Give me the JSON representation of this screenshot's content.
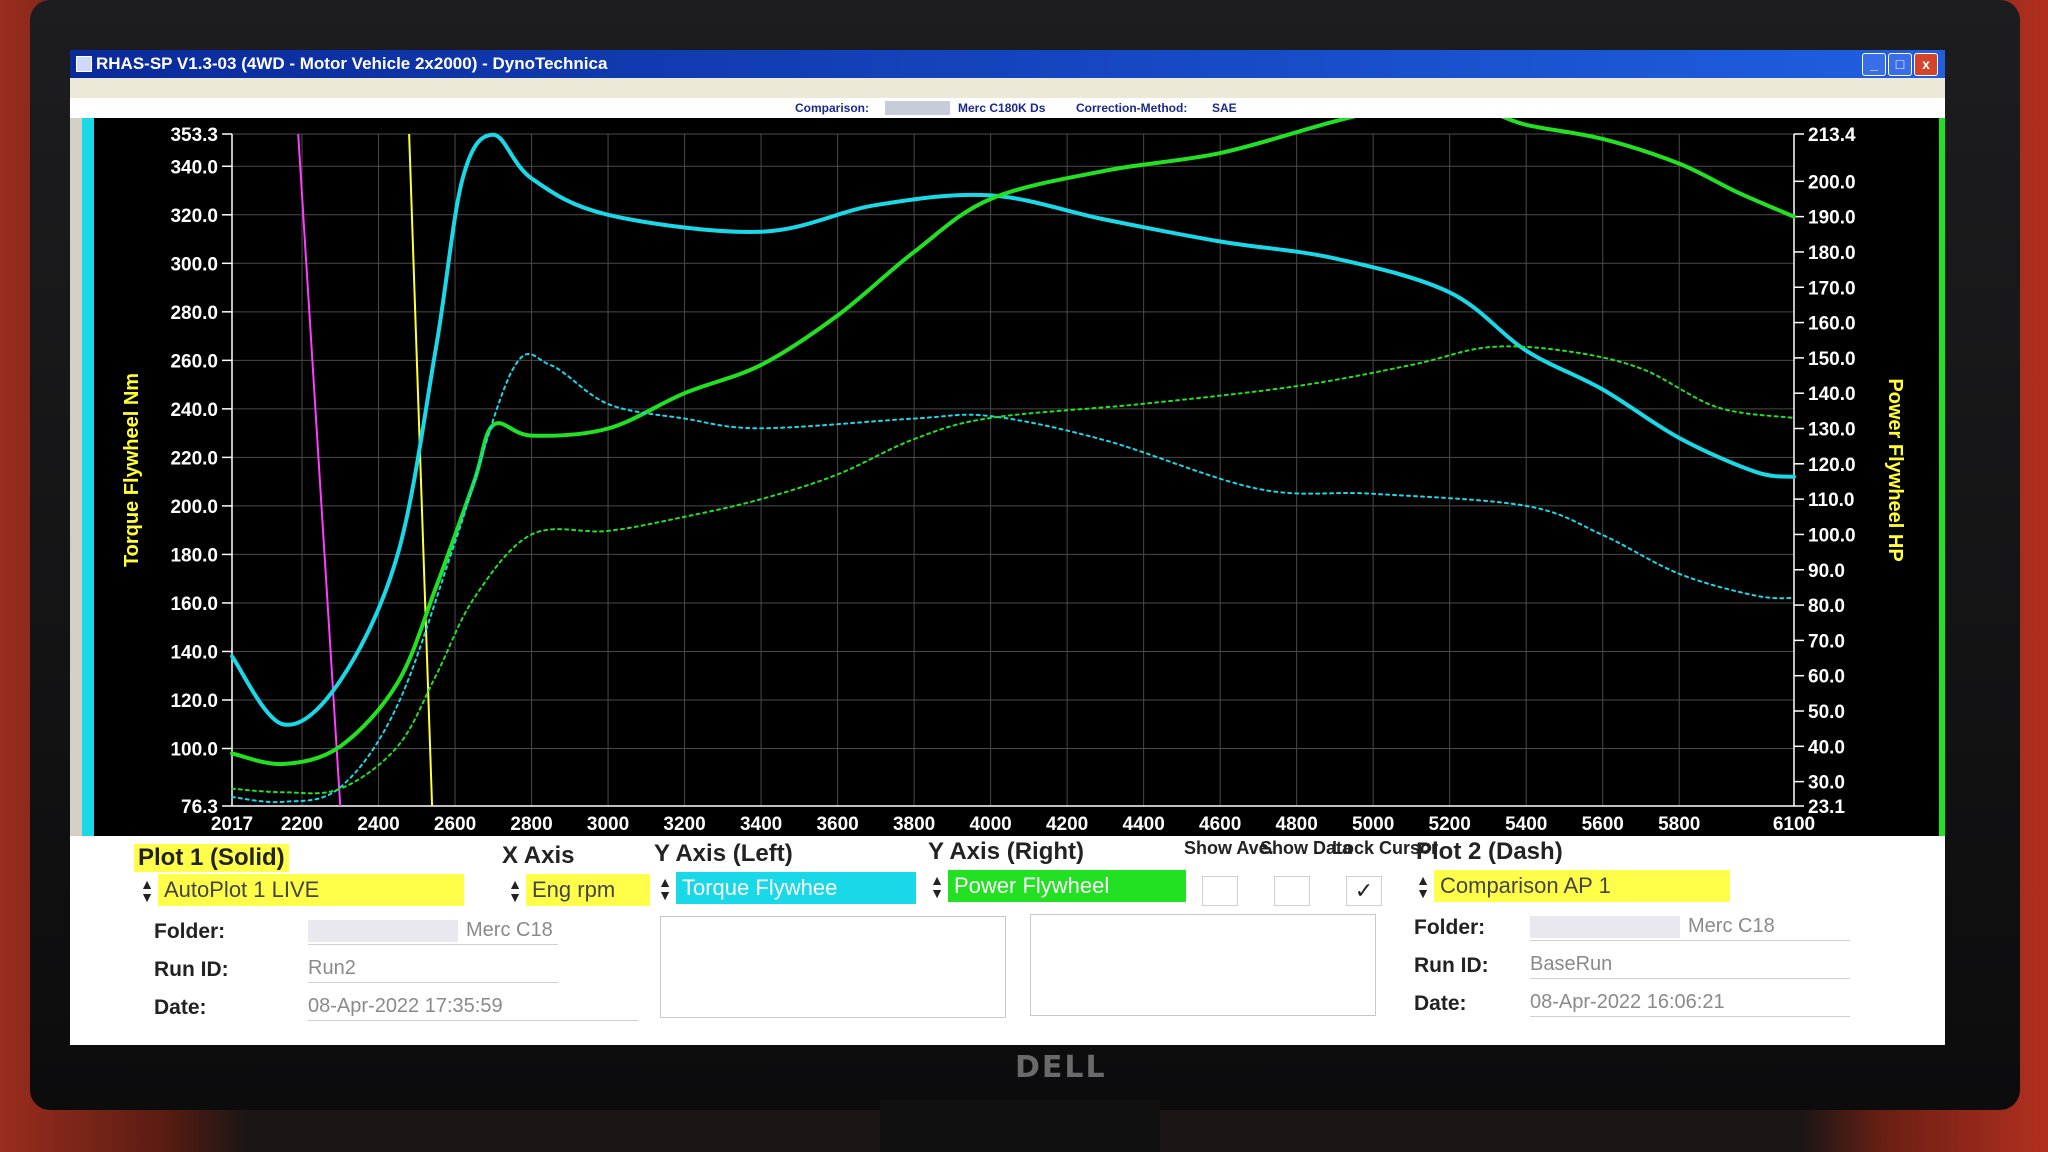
{
  "window": {
    "title": "RHAS-SP V1.3-03  (4WD - Motor Vehicle 2x2000) - DynoTechnica",
    "controls": {
      "minimize": "_",
      "maximize": "□",
      "close": "x"
    }
  },
  "infobar": {
    "comparison_label": "Comparison:",
    "comparison_value": "Merc C180K Ds",
    "correction_label": "Correction-Method:",
    "correction_value": "SAE"
  },
  "chart_data": {
    "type": "line",
    "x_ticks": [
      "2017",
      "2200",
      "2400",
      "2600",
      "2800",
      "3000",
      "3200",
      "3400",
      "3600",
      "3800",
      "4000",
      "4200",
      "4400",
      "4600",
      "4800",
      "5000",
      "5200",
      "5400",
      "5600",
      "5800",
      "6100"
    ],
    "x_range": [
      2017,
      6100
    ],
    "y_left": {
      "label": "Torque Flywheel Nm",
      "range": [
        76.3,
        353.3
      ],
      "ticks": [
        "353.3",
        "340.0",
        "320.0",
        "300.0",
        "280.0",
        "260.0",
        "240.0",
        "220.0",
        "200.0",
        "180.0",
        "160.0",
        "140.0",
        "120.0",
        "100.0",
        "76.3"
      ]
    },
    "y_right": {
      "label": "Power Flywheel HP",
      "range": [
        23.1,
        213.4
      ],
      "ticks": [
        "213.4",
        "200.0",
        "190.0",
        "180.0",
        "170.0",
        "160.0",
        "150.0",
        "140.0",
        "130.0",
        "120.0",
        "110.0",
        "100.0",
        "90.0",
        "80.0",
        "70.0",
        "60.0",
        "50.0",
        "40.0",
        "30.0",
        "23.1"
      ]
    },
    "grid": true,
    "series": [
      {
        "axis": "left",
        "color": "#19d8e8",
        "style": "solid",
        "x": [
          2017,
          2150,
          2300,
          2450,
          2550,
          2620,
          2700,
          2800,
          3000,
          3400,
          3700,
          4000,
          4300,
          4600,
          4900,
          5200,
          5400,
          5600,
          5800,
          6000,
          6100
        ],
        "y": [
          138,
          110,
          128,
          180,
          265,
          335,
          353,
          335,
          320,
          313,
          324,
          328,
          318,
          309,
          302,
          288,
          264,
          248,
          228,
          214,
          212
        ]
      },
      {
        "axis": "right",
        "color": "#22e022",
        "style": "solid",
        "x": [
          2017,
          2150,
          2300,
          2450,
          2550,
          2650,
          2700,
          2800,
          3000,
          3200,
          3400,
          3600,
          3800,
          4000,
          4300,
          4600,
          4900,
          5100,
          5200,
          5300,
          5400,
          5600,
          5800,
          5950,
          6100
        ],
        "y": [
          38,
          35,
          40,
          58,
          85,
          115,
          131,
          128,
          130,
          140,
          148,
          162,
          180,
          195,
          203,
          208,
          217,
          222,
          223,
          220,
          216,
          212,
          205,
          197,
          190
        ]
      },
      {
        "axis": "left",
        "color": "#19d8e8",
        "style": "dash",
        "x": [
          2017,
          2150,
          2300,
          2450,
          2600,
          2750,
          2850,
          3000,
          3200,
          3400,
          3800,
          4000,
          4300,
          4700,
          5000,
          5400,
          5600,
          5800,
          6000,
          6100
        ],
        "y": [
          80,
          78,
          84,
          118,
          185,
          256,
          258,
          242,
          236,
          232,
          236,
          237,
          227,
          207,
          205,
          200,
          188,
          172,
          163,
          162
        ]
      },
      {
        "axis": "right",
        "color": "#22e022",
        "style": "dash",
        "x": [
          2017,
          2150,
          2300,
          2450,
          2550,
          2650,
          2800,
          3000,
          3200,
          3400,
          3600,
          3800,
          4000,
          4400,
          4800,
          5100,
          5300,
          5500,
          5700,
          5900,
          6100
        ],
        "y": [
          28,
          27,
          28,
          40,
          60,
          82,
          100,
          101,
          105,
          110,
          117,
          127,
          133,
          137,
          142,
          148,
          153,
          152,
          147,
          136,
          133
        ]
      }
    ],
    "cursor_lines": [
      {
        "color": "#ff3cff",
        "x_top": 2190,
        "x_bottom": 2300
      },
      {
        "color": "#ffff33",
        "x_top": 2480,
        "x_bottom": 2540
      }
    ]
  },
  "panel": {
    "plot1": {
      "header": "Plot 1 (Solid)",
      "select": "AutoPlot 1 LIVE",
      "folder_label": "Folder:",
      "folder_value": "Merc C18",
      "runid_label": "Run ID:",
      "runid_value": "Run2",
      "date_label": "Date:",
      "date_value": "08-Apr-2022   17:35:59"
    },
    "x_axis": {
      "header": "X Axis",
      "select": "Eng rpm"
    },
    "y_left": {
      "header": "Y Axis (Left)",
      "select": "Torque Flywhee"
    },
    "y_right": {
      "header": "Y Axis (Right)",
      "select": "Power Flywheel"
    },
    "options": {
      "show_ave": "Show Ave.",
      "show_data": "Show Data",
      "lock_cursor": "Lock Cursor",
      "lock_cursor_checked": "✓"
    },
    "plot2": {
      "header": "Plot 2 (Dash)",
      "select": "Comparison AP 1",
      "folder_label": "Folder:",
      "folder_value": "Merc C18",
      "runid_label": "Run ID:",
      "runid_value": "BaseRun",
      "date_label": "Date:",
      "date_value": "08-Apr-2022   16:06:21"
    }
  },
  "bezel": {
    "brand": "DELL"
  }
}
